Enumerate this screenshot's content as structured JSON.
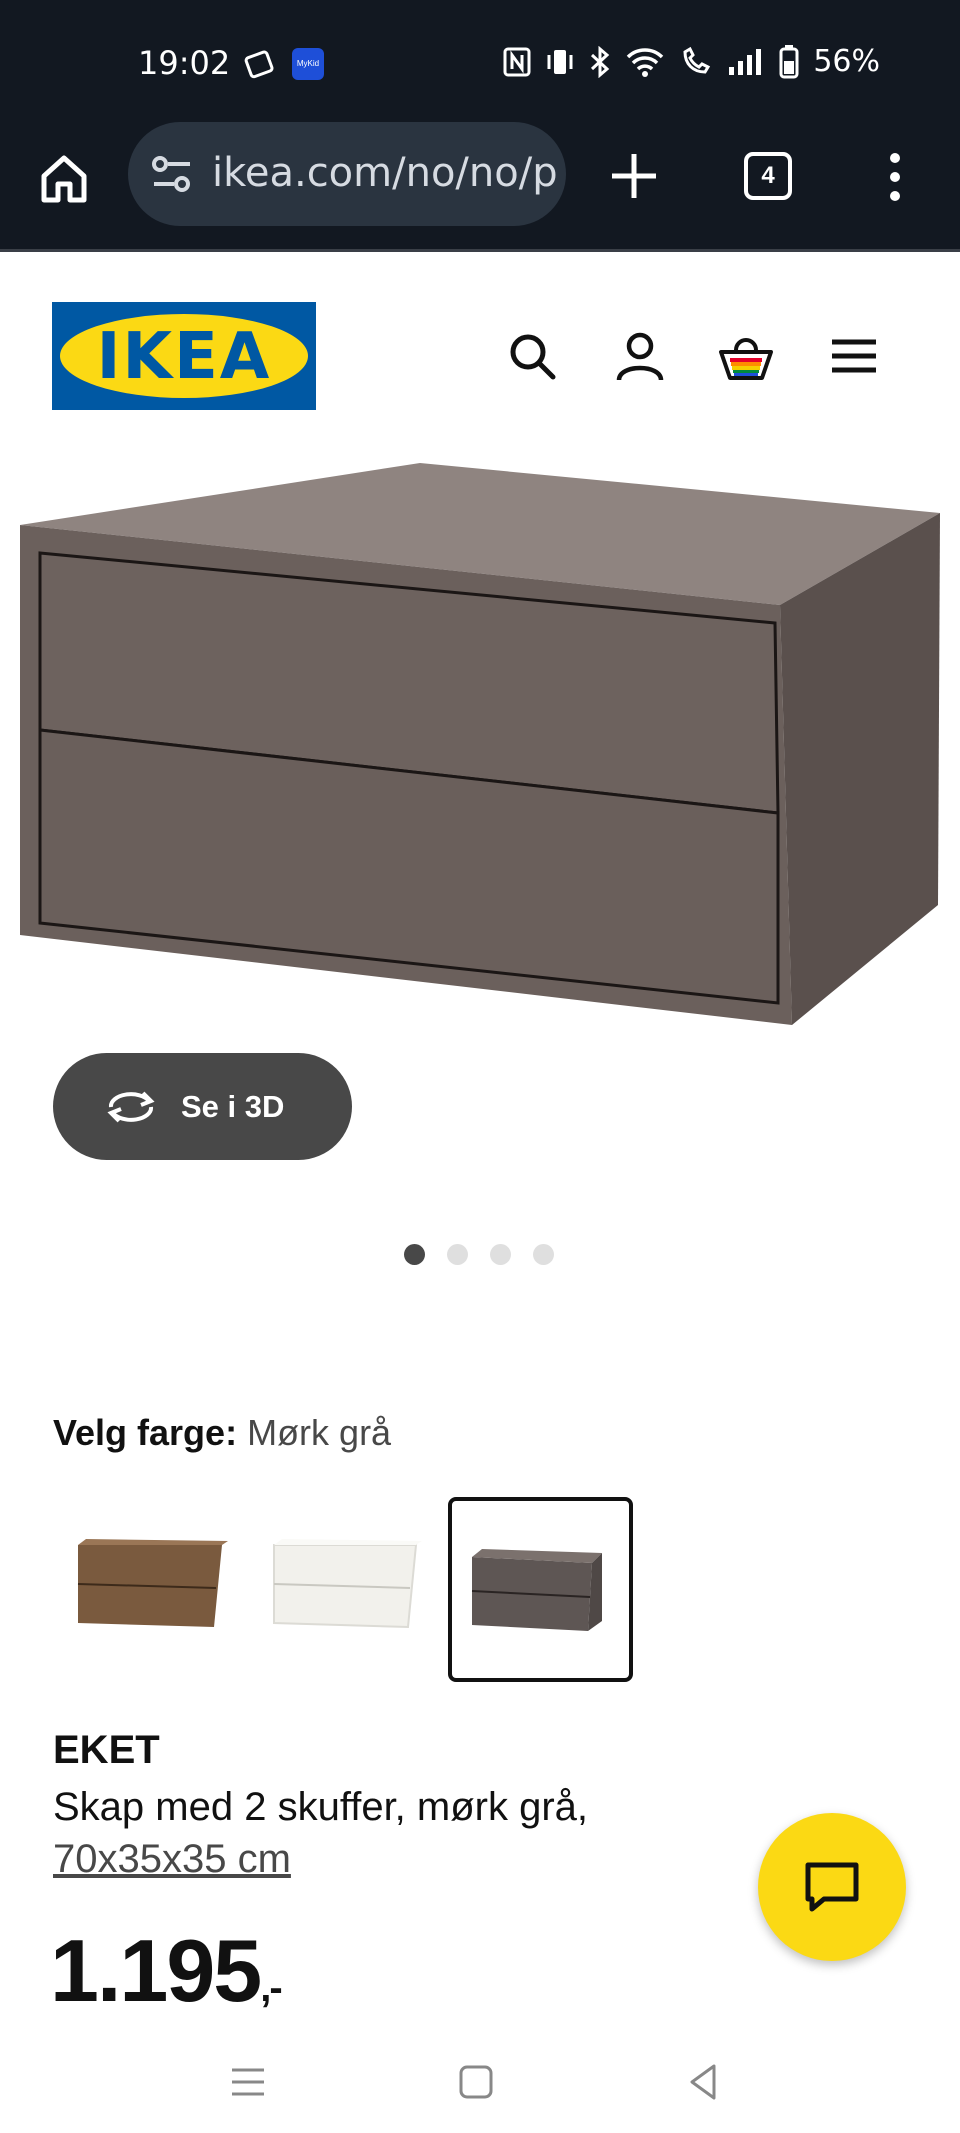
{
  "status_bar": {
    "time": "19:02",
    "battery_percent": "56%",
    "icons": [
      "nfc-icon",
      "vibrate-icon",
      "bluetooth-icon",
      "wifi-icon",
      "wifi-call-icon",
      "signal-icon",
      "battery-icon"
    ]
  },
  "browser": {
    "url": "ikea.com/no/no/p",
    "tab_count": "4"
  },
  "site": {
    "logo_text": "IKEA",
    "brand_blue": "#0058a3",
    "brand_yellow": "#fbd914"
  },
  "gallery": {
    "view_3d_label": "Se i 3D",
    "slide_count": 4,
    "active_slide": 1
  },
  "color_select": {
    "label": "Velg farge:",
    "value": "Mørk grå",
    "options": [
      {
        "name": "walnut-swatch",
        "color": "#7a5a3e"
      },
      {
        "name": "white-swatch",
        "color": "#f2f1ec"
      },
      {
        "name": "dark-grey-swatch",
        "color": "#5e5654",
        "selected": true
      }
    ]
  },
  "product": {
    "name": "EKET",
    "description": "Skap med 2 skuffer, mørk grå,",
    "size": "70x35x35 cm",
    "price": "1.195",
    "price_suffix": ",-"
  }
}
